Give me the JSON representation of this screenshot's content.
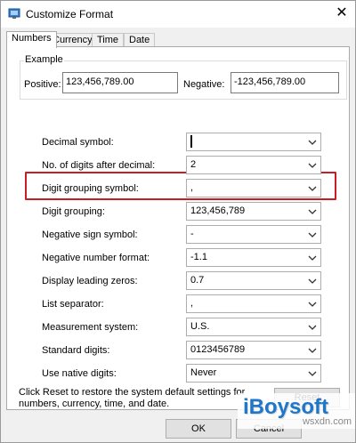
{
  "window": {
    "title": "Customize Format",
    "close_glyph": "✕"
  },
  "tabs": [
    {
      "label": "Numbers",
      "active": true
    },
    {
      "label": "Currency",
      "active": false
    },
    {
      "label": "Time",
      "active": false
    },
    {
      "label": "Date",
      "active": false
    }
  ],
  "example": {
    "group_label": "Example",
    "positive_label": "Positive:",
    "positive_value": "123,456,789.00",
    "negative_label": "Negative:",
    "negative_value": "-123,456,789.00"
  },
  "settings": [
    {
      "label": "Decimal symbol:",
      "value": "",
      "highlighted": true
    },
    {
      "label": "No. of digits after decimal:",
      "value": "2"
    },
    {
      "label": "Digit grouping symbol:",
      "value": ","
    },
    {
      "label": "Digit grouping:",
      "value": "123,456,789"
    },
    {
      "label": "Negative sign symbol:",
      "value": "-"
    },
    {
      "label": "Negative number format:",
      "value": "-1.1"
    },
    {
      "label": "Display leading zeros:",
      "value": "0.7"
    },
    {
      "label": "List separator:",
      "value": ","
    },
    {
      "label": "Measurement system:",
      "value": "U.S."
    },
    {
      "label": "Standard digits:",
      "value": "0123456789"
    },
    {
      "label": "Use native digits:",
      "value": "Never"
    }
  ],
  "footer": {
    "reset_note_line1": "Click Reset to restore the system default settings for",
    "reset_note_line2": "numbers, currency, time, and date.",
    "reset_label": "Reset",
    "ok_label": "OK",
    "cancel_label": "Cancel"
  },
  "watermark": {
    "brand": "iBoysoft",
    "site": "wsxdn.com"
  },
  "colors": {
    "highlight": "#c91d24",
    "brand": "#1e77c9"
  }
}
